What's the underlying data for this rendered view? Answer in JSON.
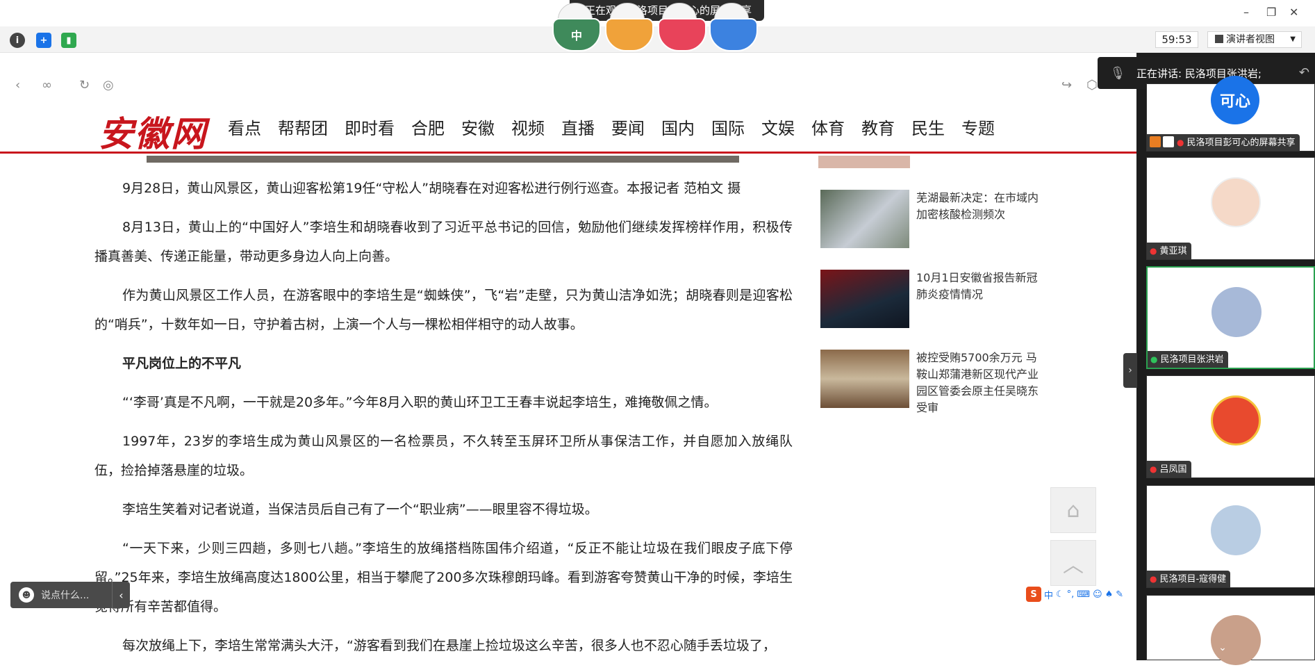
{
  "meeting": {
    "share_banner": "正在观看民洛项目彭可心的屏幕共享",
    "timer": "59:53",
    "view_mode": "演讲者视图",
    "speaking_label": "正在讲话: 民洛项目张洪岩;",
    "cups": [
      "中",
      "",
      "",
      ""
    ]
  },
  "browser": {
    "site_logo": "安徽网",
    "menu": [
      "看点",
      "帮帮团",
      "即时看",
      "合肥",
      "安徽",
      "视频",
      "直播",
      "要闻",
      "国内",
      "国际",
      "文娱",
      "体育",
      "教育",
      "民生",
      "专题"
    ]
  },
  "article": {
    "paragraphs": [
      "9月28日，黄山风景区，黄山迎客松第19任“守松人”胡晓春在对迎客松进行例行巡查。本报记者 范柏文 摄",
      "8月13日，黄山上的“中国好人”李培生和胡晓春收到了习近平总书记的回信，勉励他们继续发挥榜样作用，积极传播真善美、传递正能量，带动更多身边人向上向善。",
      "作为黄山风景区工作人员，在游客眼中的李培生是“蜘蛛侠”，飞“岩”走壁，只为黄山洁净如洗；胡晓春则是迎客松的“哨兵”，十数年如一日，守护着古树，上演一个人与一棵松相伴相守的动人故事。",
      "平凡岗位上的不平凡",
      "“‘李哥’真是不凡啊，一干就是20多年。”今年8月入职的黄山环卫工王春丰说起李培生，难掩敬佩之情。",
      "1997年，23岁的李培生成为黄山风景区的一名检票员，不久转至玉屏环卫所从事保洁工作，并自愿加入放绳队伍，捡拾掉落悬崖的垃圾。",
      "李培生笑着对记者说道，当保洁员后自己有了一个“职业病”——眼里容不得垃圾。",
      "“一天下来，少则三四趟，多则七八趟。”李培生的放绳搭档陈国伟介绍道，“反正不能让垃圾在我们眼皮子底下停留。”25年来，李培生放绳高度达1800公里，相当于攀爬了200多次珠穆朗玛峰。看到游客夸赞黄山干净的时候，李培生觉得所有辛苦都值得。",
      "每次放绳上下，李培生常常满头大汗，“游客看到我们在悬崖上捡垃圾这么辛苦，很多人也不忍心随手丢垃圾了，"
    ]
  },
  "sidebar": {
    "news": [
      {
        "title": "芜湖最新决定：在市域内加密核酸检测频次"
      },
      {
        "title": "10月1日安徽省报告新冠肺炎疫情情况"
      },
      {
        "title": "被控受贿5700余万元 马鞍山郑蒲港新区现代产业园区管委会原主任吴晓东受审"
      }
    ]
  },
  "chat": {
    "placeholder": "说点什么..."
  },
  "ime": {
    "label": "中"
  },
  "participants": [
    {
      "name": "民洛项目彭可心的屏幕共享",
      "avatar_text": "可心",
      "color": "#1a73e8"
    },
    {
      "name": "黄亚琪",
      "avatar_text": "",
      "color": "#f5d9c8"
    },
    {
      "name": "民洛项目张洪岩",
      "avatar_text": "",
      "color": "#a7b9d8"
    },
    {
      "name": "吕凤国",
      "avatar_text": "",
      "color": "#e84a2e"
    },
    {
      "name": "民洛项目-寇得健",
      "avatar_text": "",
      "color": "#b9cde3"
    }
  ]
}
